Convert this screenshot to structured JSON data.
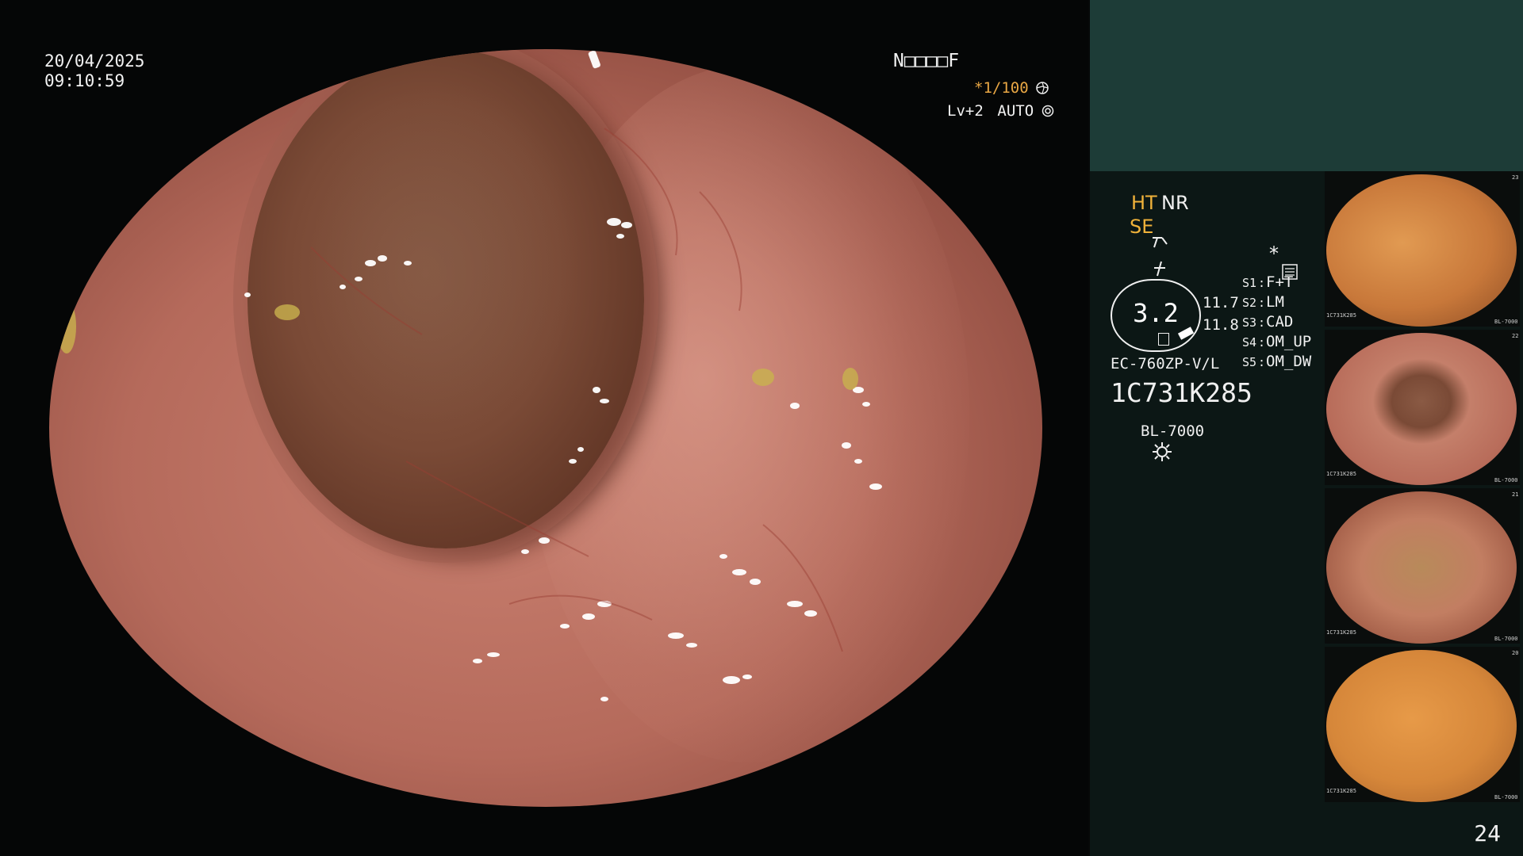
{
  "overlay": {
    "date": "20/04/2025",
    "time": "09:10:59",
    "patient_code": "N□□□□F",
    "shutter": "*1/100",
    "shutter_icon": "aperture-icon",
    "level": "Lv+2",
    "mode": "AUTO",
    "mode_icon": "gear-icon"
  },
  "panel": {
    "ht_label": "HT",
    "nr_label": "NR",
    "se_label": "SE",
    "scope_value": "3.2",
    "value_1": "11.7",
    "value_2": "11.8",
    "scope_model": "EC-760ZP-V/L",
    "serial": "1C731K285",
    "light_source": "BL-7000",
    "star": "*",
    "switches": [
      {
        "key": "S1",
        "value": "F+T"
      },
      {
        "key": "S2",
        "value": "LM"
      },
      {
        "key": "S3",
        "value": "CAD"
      },
      {
        "key": "S4",
        "value": "OM_UP"
      },
      {
        "key": "S5",
        "value": "OM_DW"
      }
    ],
    "thumbnails": [
      {
        "serial": "1C731K285",
        "light": "BL-7000",
        "index": "23"
      },
      {
        "serial": "1C731K285",
        "light": "BL-7000",
        "index": "22"
      },
      {
        "serial": "1C731K285",
        "light": "BL-7000",
        "index": "21"
      },
      {
        "serial": "1C731K285",
        "light": "BL-7000",
        "index": "20"
      }
    ],
    "page_number": "24"
  },
  "colors": {
    "accent_orange": "#f0b23a",
    "panel_bg": "#0c1715",
    "panel_top": "#1d3c37"
  }
}
